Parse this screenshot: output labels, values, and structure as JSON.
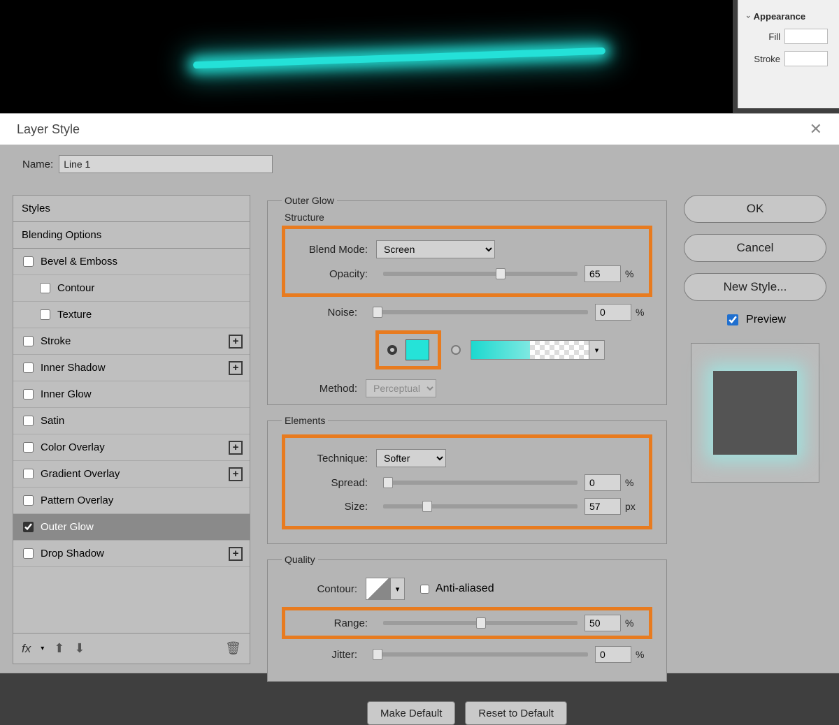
{
  "appearance": {
    "header": "Appearance",
    "fill": "Fill",
    "stroke": "Stroke"
  },
  "dialog": {
    "title": "Layer Style",
    "name_label": "Name:",
    "name_value": "Line 1",
    "styles_header": "Styles",
    "blending_header": "Blending Options",
    "style_items": [
      {
        "label": "Bevel & Emboss",
        "checked": false,
        "add": false
      },
      {
        "label": "Contour",
        "checked": false,
        "indent": true
      },
      {
        "label": "Texture",
        "checked": false,
        "indent": true
      },
      {
        "label": "Stroke",
        "checked": false,
        "add": true
      },
      {
        "label": "Inner Shadow",
        "checked": false,
        "add": true
      },
      {
        "label": "Inner Glow",
        "checked": false
      },
      {
        "label": "Satin",
        "checked": false
      },
      {
        "label": "Color Overlay",
        "checked": false,
        "add": true
      },
      {
        "label": "Gradient Overlay",
        "checked": false,
        "add": true
      },
      {
        "label": "Pattern Overlay",
        "checked": false
      },
      {
        "label": "Outer Glow",
        "checked": true,
        "selected": true
      },
      {
        "label": "Drop Shadow",
        "checked": false,
        "add": true
      }
    ],
    "fx_label": "fx",
    "main_group": "Outer Glow",
    "structure": {
      "legend": "Structure",
      "blend_mode_label": "Blend Mode:",
      "blend_mode_value": "Screen",
      "opacity_label": "Opacity:",
      "opacity_value": "65",
      "opacity_unit": "%",
      "noise_label": "Noise:",
      "noise_value": "0",
      "noise_unit": "%",
      "method_label": "Method:",
      "method_value": "Perceptual",
      "glow_color": "#25e3d8"
    },
    "elements": {
      "legend": "Elements",
      "technique_label": "Technique:",
      "technique_value": "Softer",
      "spread_label": "Spread:",
      "spread_value": "0",
      "spread_unit": "%",
      "size_label": "Size:",
      "size_value": "57",
      "size_unit": "px"
    },
    "quality": {
      "legend": "Quality",
      "contour_label": "Contour:",
      "antialiased_label": "Anti-aliased",
      "range_label": "Range:",
      "range_value": "50",
      "range_unit": "%",
      "jitter_label": "Jitter:",
      "jitter_value": "0",
      "jitter_unit": "%"
    },
    "make_default": "Make Default",
    "reset_default": "Reset to Default",
    "ok": "OK",
    "cancel": "Cancel",
    "new_style": "New Style...",
    "preview": "Preview"
  }
}
